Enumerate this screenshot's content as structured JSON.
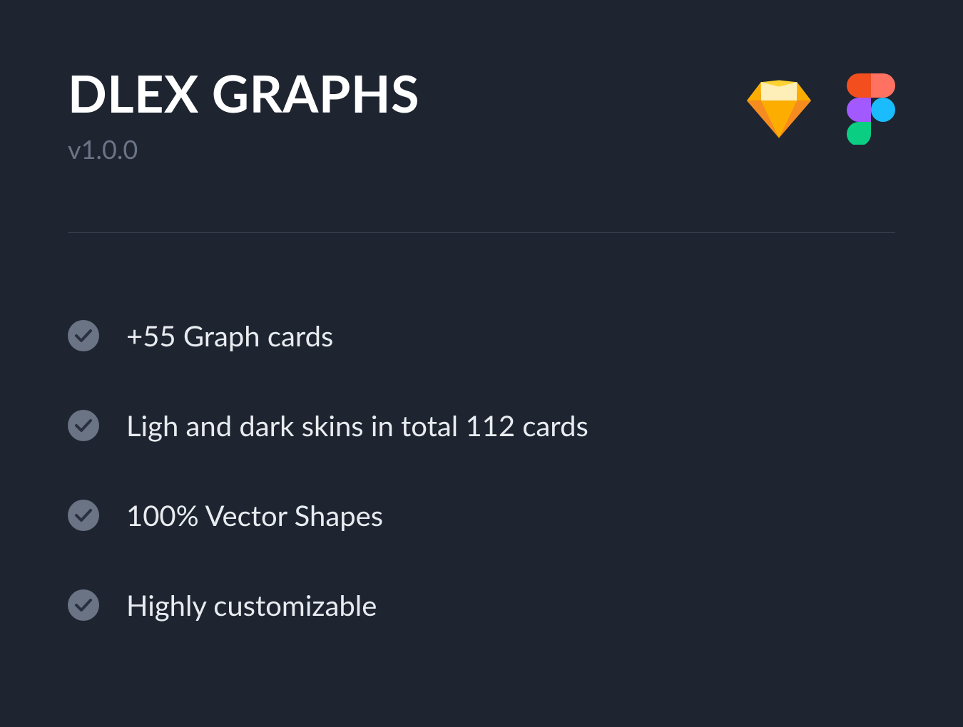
{
  "header": {
    "title": "DLEX GRAPHS",
    "version": "v1.0.0"
  },
  "features": [
    {
      "text": "+55 Graph cards"
    },
    {
      "text": "Ligh and dark skins in total 112 cards"
    },
    {
      "text": "100% Vector Shapes"
    },
    {
      "text": "Highly customizable"
    }
  ],
  "icons": {
    "sketch": "sketch-icon",
    "figma": "figma-icon"
  },
  "colors": {
    "background": "#1e2430",
    "title": "#ffffff",
    "version": "#6a7485",
    "featureText": "#e8ebef",
    "divider": "#3a4252",
    "checkBg": "#6a7485",
    "checkMark": "#2a3040"
  }
}
